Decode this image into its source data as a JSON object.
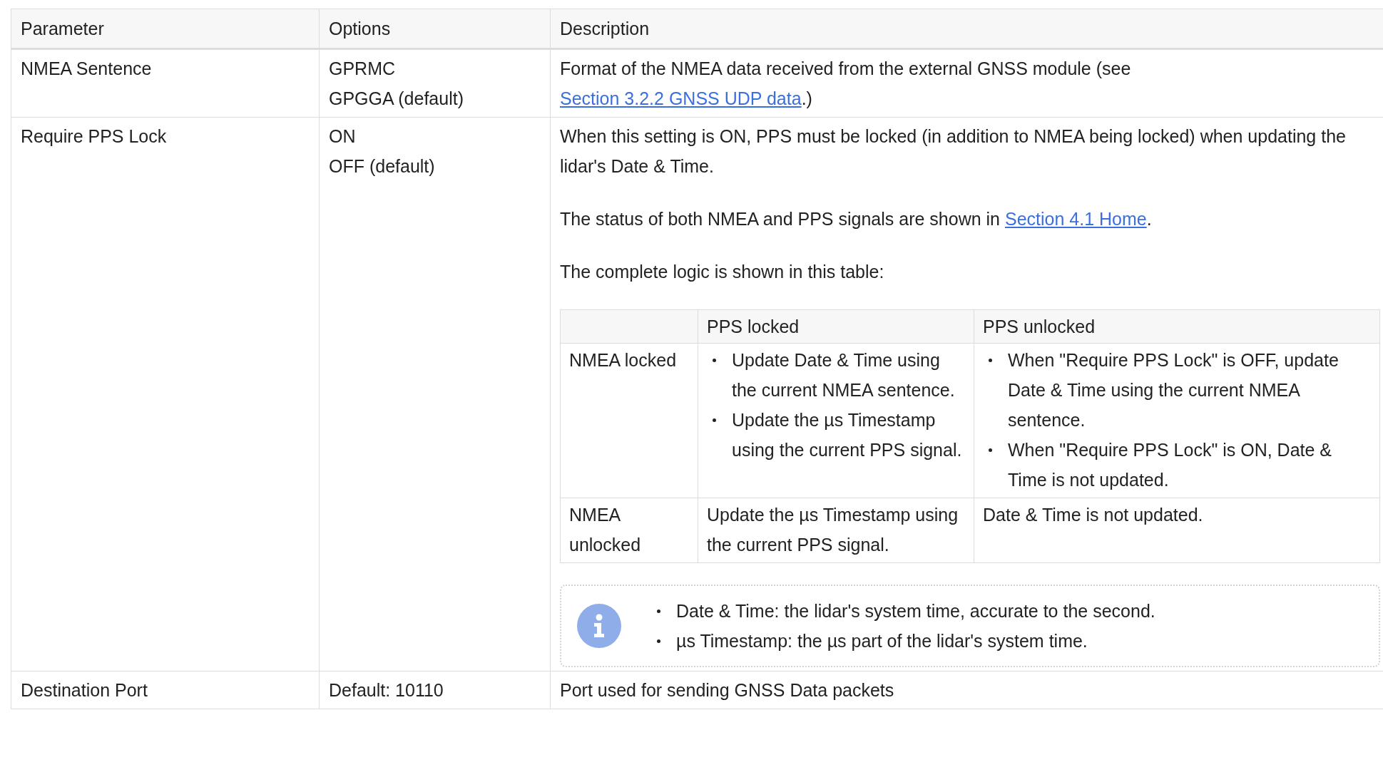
{
  "table": {
    "columns": [
      "Parameter",
      "Options",
      "Description"
    ],
    "rows": [
      {
        "parameter": "NMEA Sentence",
        "options": [
          "GPRMC",
          "GPGGA (default)"
        ],
        "description": [
          {
            "kind": "paragraph",
            "parts": [
              {
                "kind": "text",
                "text": "Format of the NMEA data received from the external GNSS module (see "
              },
              {
                "kind": "link",
                "text": "Section 3.2.2 GNSS UDP data"
              },
              {
                "kind": "text",
                "text": ".)"
              }
            ]
          }
        ]
      },
      {
        "parameter": "Require PPS Lock",
        "options": [
          "ON",
          "OFF (default)"
        ],
        "description": [
          {
            "kind": "paragraph",
            "parts": [
              {
                "kind": "text",
                "text": "When this setting is ON, PPS must be locked (in addition to NMEA being locked) when updating the lidar's Date & Time."
              }
            ]
          },
          {
            "kind": "paragraph",
            "parts": [
              {
                "kind": "text",
                "text": "The status of both NMEA and PPS signals are shown in "
              },
              {
                "kind": "link",
                "text": "Section 4.1 Home"
              },
              {
                "kind": "text",
                "text": "."
              }
            ]
          },
          {
            "kind": "paragraph",
            "parts": [
              {
                "kind": "text",
                "text": "The complete logic is shown in this table:"
              }
            ]
          },
          {
            "kind": "table",
            "columns": [
              "PPS locked",
              "PPS unlocked"
            ],
            "rows": [
              {
                "header": "NMEA locked",
                "cells": [
                  {
                    "kind": "bullets",
                    "items": [
                      "Update Date & Time using the current NMEA sentence.",
                      "Update the µs Timestamp using the current PPS signal."
                    ]
                  },
                  {
                    "kind": "bullets",
                    "items": [
                      "When \"Require PPS Lock\" is OFF, update Date & Time using the current NMEA sentence.",
                      "When \"Require PPS Lock\" is ON, Date & Time is not updated."
                    ]
                  }
                ]
              },
              {
                "header": "NMEA unlocked",
                "cells": [
                  {
                    "kind": "text",
                    "text": "Update the µs Timestamp using the current PPS signal."
                  },
                  {
                    "kind": "text",
                    "text": "Date & Time is not updated."
                  }
                ]
              }
            ]
          },
          {
            "kind": "note",
            "items": [
              "Date & Time: the lidar's system time, accurate to the second.",
              "µs Timestamp: the µs part of the lidar's system time."
            ]
          }
        ]
      },
      {
        "parameter": "Destination Port",
        "options": [
          "Default: 10110"
        ],
        "description": [
          {
            "kind": "paragraph",
            "parts": [
              {
                "kind": "text",
                "text": "Port used for sending GNSS Data packets"
              }
            ]
          }
        ]
      }
    ]
  }
}
